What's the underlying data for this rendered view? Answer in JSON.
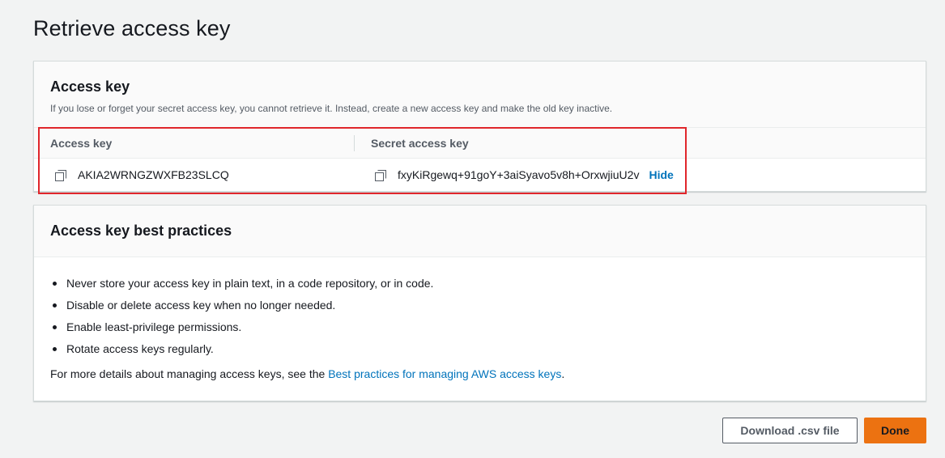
{
  "page": {
    "title": "Retrieve access key"
  },
  "access_key_section": {
    "heading": "Access key",
    "description": "If you lose or forget your secret access key, you cannot retrieve it. Instead, create a new access key and make the old key inactive.",
    "columns": [
      "Access key",
      "Secret access key"
    ],
    "access_key_id": "AKIA2WRNGZWXFB23SLCQ",
    "secret_access_key": "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",
    "hide_label": "Hide"
  },
  "best_practices": {
    "heading": "Access key best practices",
    "items": [
      "Never store your access key in plain text, in a code repository, or in code.",
      "Disable or delete access key when no longer needed.",
      "Enable least-privilege permissions.",
      "Rotate access keys regularly."
    ],
    "more_prefix": "For more details about managing access keys, see the ",
    "more_link": "Best practices for managing AWS access keys",
    "more_suffix": "."
  },
  "footer": {
    "download_label": "Download .csv file",
    "done_label": "Done"
  },
  "colors": {
    "link": "#0073bb",
    "primary": "#ec7211",
    "highlight": "#e0262b",
    "background": "#f2f3f3"
  },
  "icons": [
    "copy-icon"
  ]
}
